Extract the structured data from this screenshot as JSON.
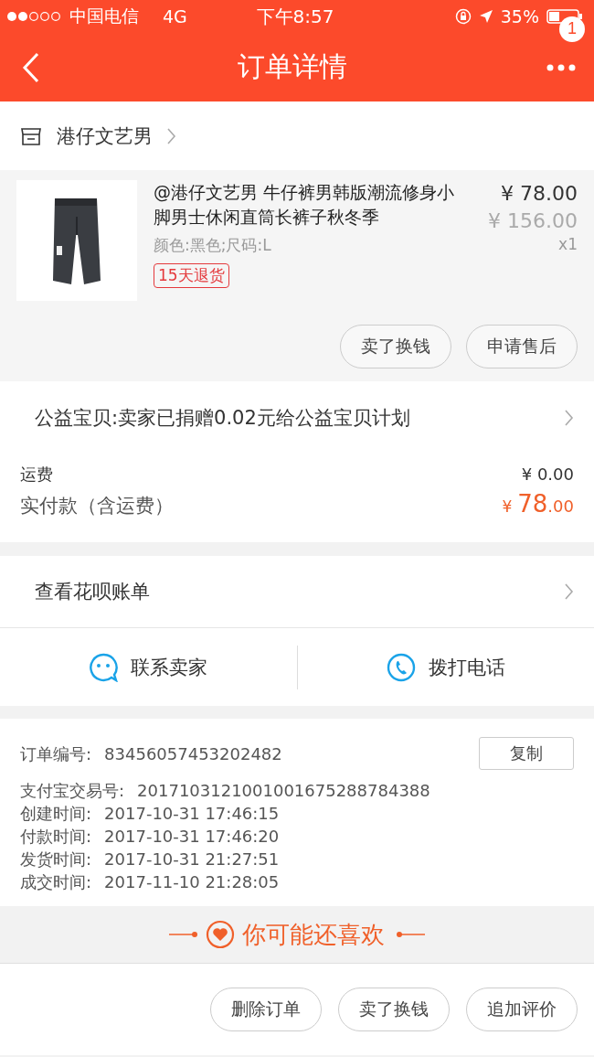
{
  "status_bar": {
    "carrier": "中国电信",
    "network": "4G",
    "time": "下午8:57",
    "battery": "35%"
  },
  "nav": {
    "title": "订单详情",
    "badge": "1"
  },
  "shop": {
    "name": "港仔文艺男"
  },
  "product": {
    "title": "@港仔文艺男 牛仔裤男韩版潮流修身小脚男士休闲直筒长裤子秋冬季",
    "variant": "颜色:黑色;尺码:L",
    "tag": "15天退货",
    "price": "¥ 78.00",
    "original_price": "¥ 156.00",
    "quantity": "x1",
    "actions": [
      "卖了换钱",
      "申请售后"
    ]
  },
  "charity": {
    "text": "公益宝贝:卖家已捐赠0.02元给公益宝贝计划"
  },
  "costs": {
    "shipping_label": "运费",
    "shipping": "¥ 0.00",
    "paid_label": "实付款（含运费）",
    "paid_currency": "¥",
    "paid_int": "78",
    "paid_dec": ".00"
  },
  "huabei": {
    "text": "查看花呗账单"
  },
  "contact": [
    {
      "kind": "chat",
      "label": "联系卖家"
    },
    {
      "kind": "phone",
      "label": "拨打电话"
    }
  ],
  "order_info": {
    "copy_button": "复制",
    "rows": [
      {
        "label": "订单编号:",
        "value": "83456057453202482"
      },
      {
        "label": "支付宝交易号:",
        "value": "2017103121001001675288784388"
      },
      {
        "label": "创建时间:",
        "value": "2017-10-31 17:46:15"
      },
      {
        "label": "付款时间:",
        "value": "2017-10-31 17:46:20"
      },
      {
        "label": "发货时间:",
        "value": "2017-10-31 21:27:51"
      },
      {
        "label": "成交时间:",
        "value": "2017-11-10 21:28:05"
      }
    ]
  },
  "recommend": {
    "title": "你可能还喜欢"
  },
  "bottom_actions": [
    "删除订单",
    "卖了换钱",
    "追加评价"
  ]
}
